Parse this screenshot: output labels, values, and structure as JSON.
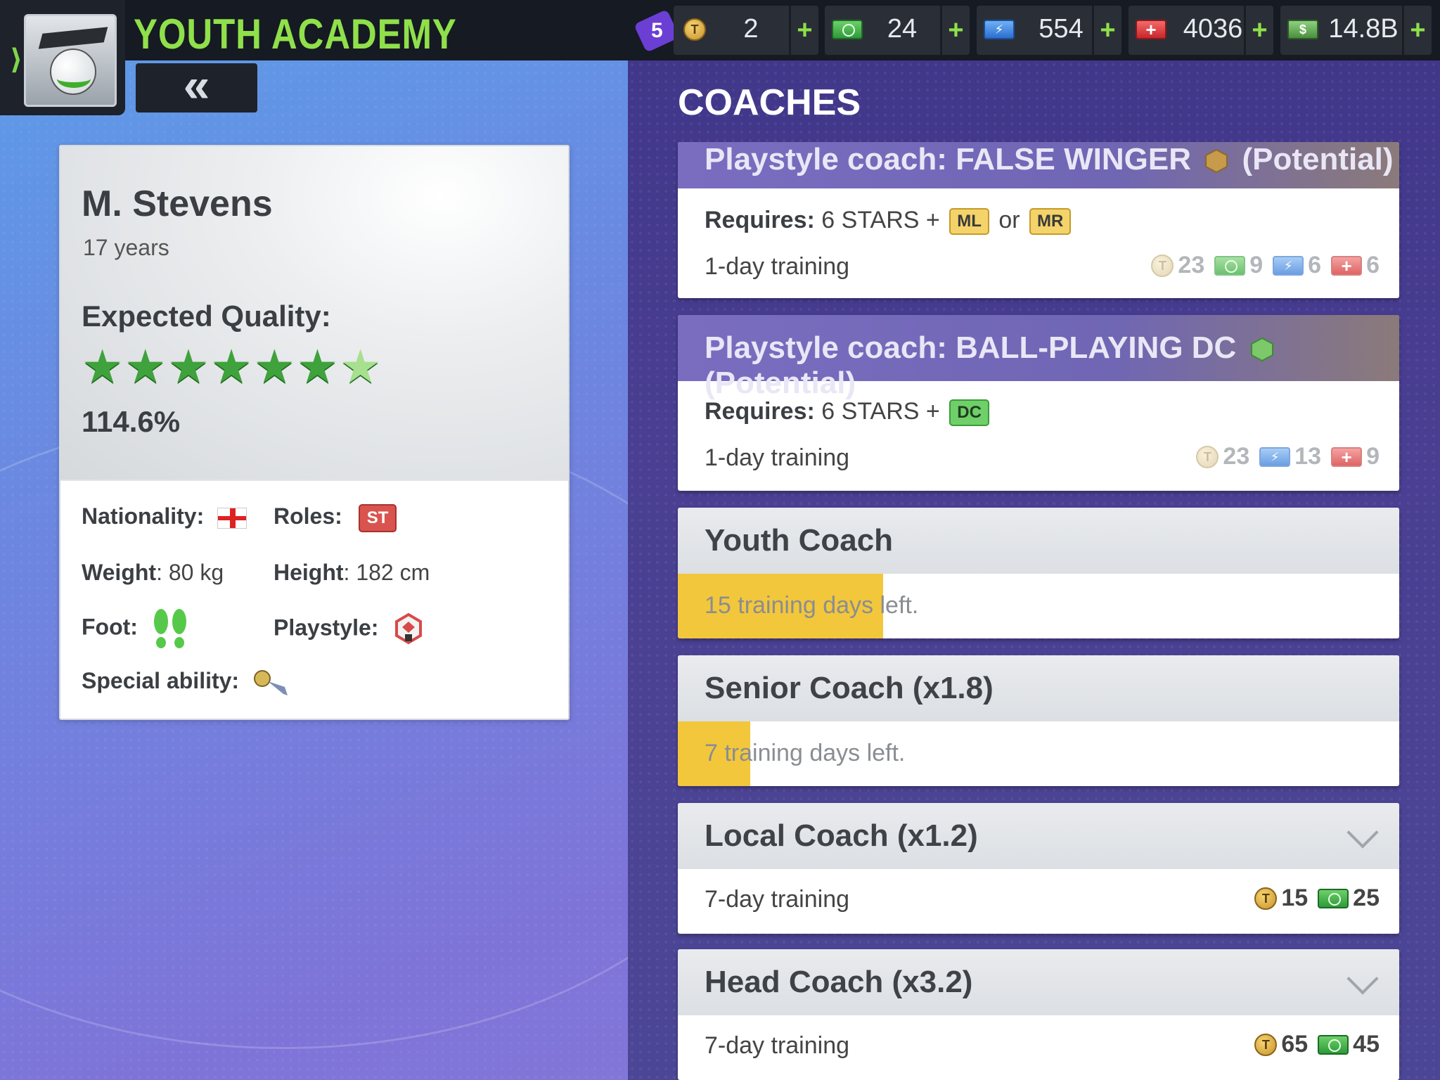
{
  "app": {
    "title": "YOUTH ACADEMY",
    "back_label": "«"
  },
  "resources": {
    "level": "5",
    "tokens": "2",
    "cash": "24",
    "energy": "554",
    "medical": "4036",
    "bank": "14.8B",
    "plus": "+"
  },
  "player": {
    "name": "M. Stevens",
    "age": "17 years",
    "expected_quality_label": "Expected Quality:",
    "stars": 6.5,
    "percent": "114.6%",
    "nationality_label": "Nationality:",
    "roles_label": "Roles:",
    "role": "ST",
    "weight_label": "Weight",
    "weight_value": ": 80 kg",
    "height_label": "Height",
    "height_value": ": 182 cm",
    "foot_label": "Foot:",
    "playstyle_label": "Playstyle:",
    "special_label": "Special ability:"
  },
  "coaches": {
    "section_title": "COACHES",
    "false_winger": {
      "title": "Playstyle coach: FALSE WINGER",
      "potential": "(Potential)",
      "requires_label": "Requires:",
      "requires_text": "6 STARS +",
      "pos1": "ML",
      "or": "or",
      "pos2": "MR",
      "duration": "1-day training",
      "cost_tokens": "23",
      "cost_cash": "9",
      "cost_energy": "6",
      "cost_medical": "6"
    },
    "ball_playing": {
      "title": "Playstyle coach: BALL-PLAYING DC",
      "potential": "(Potential)",
      "requires_label": "Requires:",
      "requires_text": "6 STARS +",
      "pos1": "DC",
      "duration": "1-day training",
      "cost_tokens": "23",
      "cost_energy": "13",
      "cost_medical": "9"
    },
    "youth": {
      "title": "Youth Coach",
      "progress_text": "15 training days left.",
      "progress": 0.285
    },
    "senior": {
      "title": "Senior Coach (x1.8)",
      "progress_text": "7 training days left.",
      "progress": 0.1
    },
    "local": {
      "title": "Local Coach (x1.2)",
      "duration": "7-day training",
      "cost_tokens": "15",
      "cost_cash": "25"
    },
    "head": {
      "title": "Head Coach (x3.2)",
      "duration": "7-day training",
      "cost_tokens": "65",
      "cost_cash": "45"
    }
  },
  "icons": {
    "coin": "coin-icon",
    "cash": "cash-icon",
    "energy": "energy-icon",
    "medical": "medical-icon",
    "bank": "bank-icon"
  },
  "colors": {
    "accent_green": "#8fe04a",
    "progress_yellow": "#f3c73c",
    "star_green": "#3fa23c"
  }
}
